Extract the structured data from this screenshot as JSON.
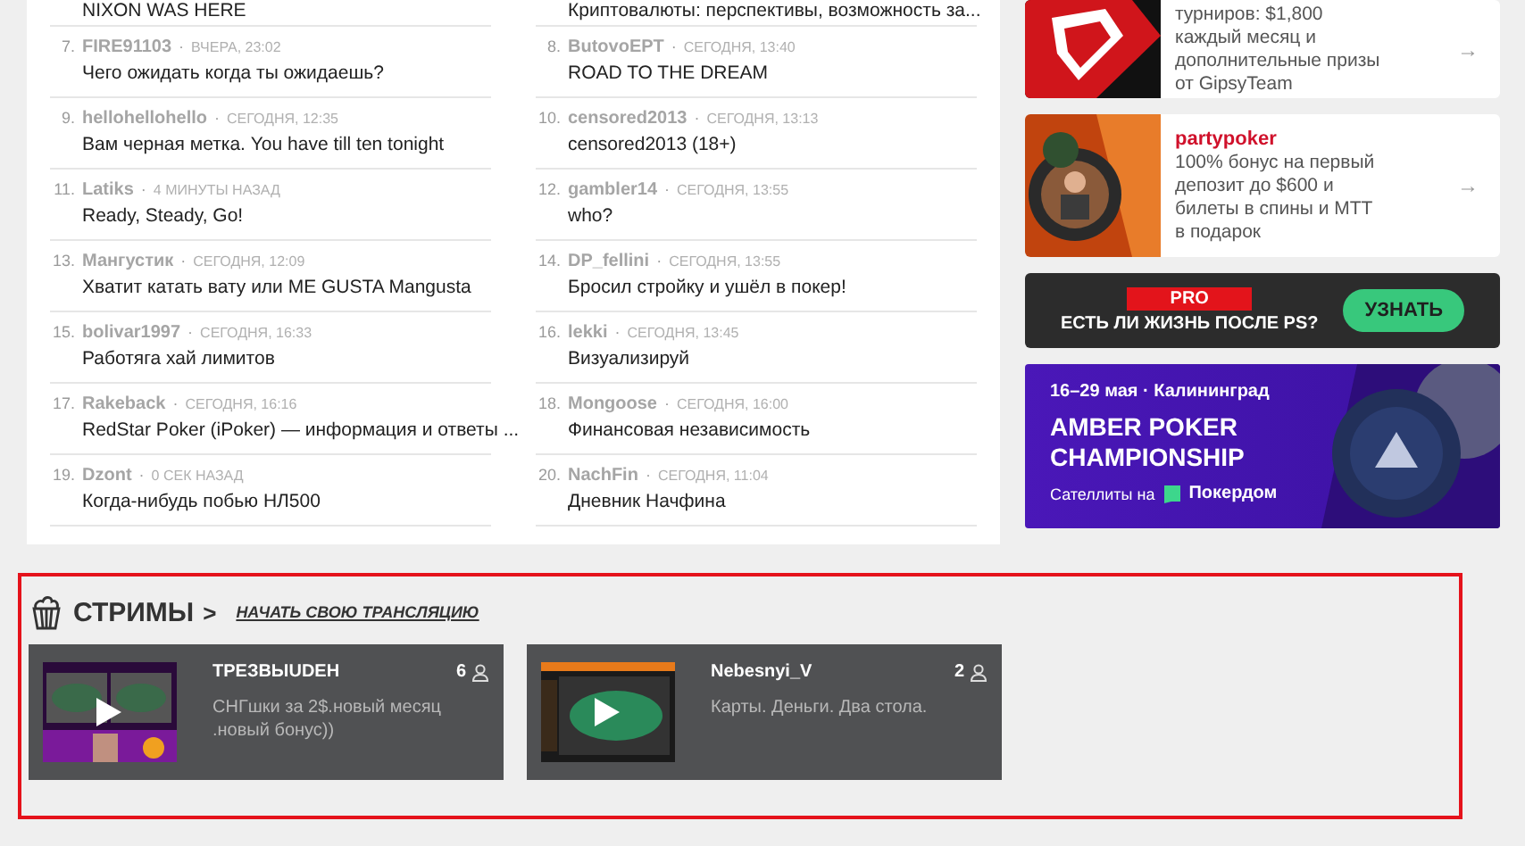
{
  "meta_separator": "·",
  "topics_left": [
    {
      "title": "NIXON WAS HERE"
    },
    {
      "number": "7.",
      "author": "FIRE91103",
      "time": "ВЧЕРА, 23:02",
      "title": "Чего ожидать когда ты ожидаешь?"
    },
    {
      "number": "9.",
      "author": "hellohellohello",
      "time": "СЕГОДНЯ, 12:35",
      "title": "Вам черная метка. You have till ten tonight"
    },
    {
      "number": "11.",
      "author": "Latiks",
      "time": "4 МИНУТЫ НАЗАД",
      "title": "Ready, Steady, Go!"
    },
    {
      "number": "13.",
      "author": "Мангустик",
      "time": "СЕГОДНЯ, 12:09",
      "title": "Хватит катать вату или ME GUSTA Mangusta"
    },
    {
      "number": "15.",
      "author": "bolivar1997",
      "time": "СЕГОДНЯ, 16:33",
      "title": "Работяга хай лимитов"
    },
    {
      "number": "17.",
      "author": "Rakeback",
      "time": "СЕГОДНЯ, 16:16",
      "title": "RedStar Poker (iPoker) — информация и ответы ..."
    },
    {
      "number": "19.",
      "author": "Dzont",
      "time": "0 СЕК НАЗАД",
      "title": "Когда-нибудь побью НЛ500"
    }
  ],
  "topics_right": [
    {
      "title": "Криптовалюты: перспективы, возможность за..."
    },
    {
      "number": "8.",
      "author": "ButovoEPT",
      "time": "СЕГОДНЯ, 13:40",
      "title": "ROAD TO THE DREAM"
    },
    {
      "number": "10.",
      "author": "censored2013",
      "time": "СЕГОДНЯ, 13:13",
      "title": "censored2013 (18+)"
    },
    {
      "number": "12.",
      "author": "gambler14",
      "time": "СЕГОДНЯ, 13:55",
      "title": "who?"
    },
    {
      "number": "14.",
      "author": "DP_fellini",
      "time": "СЕГОДНЯ, 13:55",
      "title": "Бросил стройку и ушёл в покер!"
    },
    {
      "number": "16.",
      "author": "lekki",
      "time": "СЕГОДНЯ, 13:45",
      "title": "Визуализируй"
    },
    {
      "number": "18.",
      "author": "Mongoose",
      "time": "СЕГОДНЯ, 16:00",
      "title": "Финансовая независимость"
    },
    {
      "number": "20.",
      "author": "NachFin",
      "time": "СЕГОДНЯ, 11:04",
      "title": "Дневник Начфина"
    }
  ],
  "promos": [
    {
      "lines": [
        "турниров: $1,800",
        "каждый месяц и",
        "дополнительные призы",
        "от GipsyTeam"
      ],
      "arrow": "→"
    },
    {
      "brand": "partypoker",
      "lines": [
        "100% бонус на первый",
        "депозит до $600 и",
        "билеты в спины и MTT",
        "в подарок"
      ],
      "arrow": "→"
    }
  ],
  "pro_banner": {
    "tag": "PRO",
    "text": "ЕСТЬ ЛИ ЖИЗНЬ ПОСЛЕ PS?",
    "button": "УЗНАТЬ"
  },
  "amber_banner": {
    "dates": "16–29 мая · Калининград",
    "title": "AMBER POKER CHAMPIONSHIP",
    "satellites": "Сателлиты на",
    "brand": "Покердом"
  },
  "streams": {
    "title": "СТРИМЫ",
    "chevron": ">",
    "start_link": "НАЧАТЬ СВОЮ ТРАНСЛЯЦИЮ",
    "items": [
      {
        "name": "ТРЕЗВЫUDEH",
        "viewers": "6",
        "description": "СНГшки за 2$.новый месяц .новый бонус))"
      },
      {
        "name": "Nebesnyi_V",
        "viewers": "2",
        "description": "Карты. Деньги. Два стола."
      }
    ]
  }
}
